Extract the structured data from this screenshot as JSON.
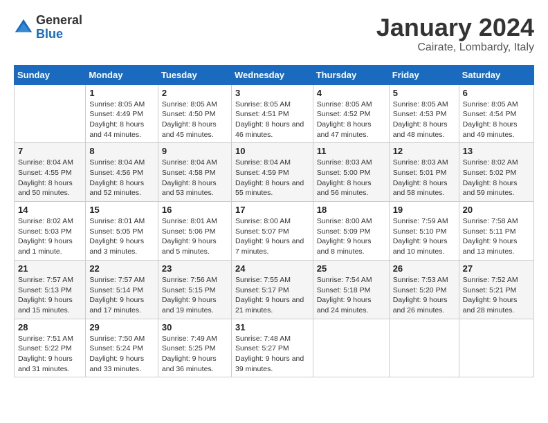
{
  "logo": {
    "general": "General",
    "blue": "Blue"
  },
  "title": "January 2024",
  "location": "Cairate, Lombardy, Italy",
  "weekdays": [
    "Sunday",
    "Monday",
    "Tuesday",
    "Wednesday",
    "Thursday",
    "Friday",
    "Saturday"
  ],
  "weeks": [
    [
      {
        "day": "",
        "sunrise": "",
        "sunset": "",
        "daylight": ""
      },
      {
        "day": "1",
        "sunrise": "Sunrise: 8:05 AM",
        "sunset": "Sunset: 4:49 PM",
        "daylight": "Daylight: 8 hours and 44 minutes."
      },
      {
        "day": "2",
        "sunrise": "Sunrise: 8:05 AM",
        "sunset": "Sunset: 4:50 PM",
        "daylight": "Daylight: 8 hours and 45 minutes."
      },
      {
        "day": "3",
        "sunrise": "Sunrise: 8:05 AM",
        "sunset": "Sunset: 4:51 PM",
        "daylight": "Daylight: 8 hours and 46 minutes."
      },
      {
        "day": "4",
        "sunrise": "Sunrise: 8:05 AM",
        "sunset": "Sunset: 4:52 PM",
        "daylight": "Daylight: 8 hours and 47 minutes."
      },
      {
        "day": "5",
        "sunrise": "Sunrise: 8:05 AM",
        "sunset": "Sunset: 4:53 PM",
        "daylight": "Daylight: 8 hours and 48 minutes."
      },
      {
        "day": "6",
        "sunrise": "Sunrise: 8:05 AM",
        "sunset": "Sunset: 4:54 PM",
        "daylight": "Daylight: 8 hours and 49 minutes."
      }
    ],
    [
      {
        "day": "7",
        "sunrise": "Sunrise: 8:04 AM",
        "sunset": "Sunset: 4:55 PM",
        "daylight": "Daylight: 8 hours and 50 minutes."
      },
      {
        "day": "8",
        "sunrise": "Sunrise: 8:04 AM",
        "sunset": "Sunset: 4:56 PM",
        "daylight": "Daylight: 8 hours and 52 minutes."
      },
      {
        "day": "9",
        "sunrise": "Sunrise: 8:04 AM",
        "sunset": "Sunset: 4:58 PM",
        "daylight": "Daylight: 8 hours and 53 minutes."
      },
      {
        "day": "10",
        "sunrise": "Sunrise: 8:04 AM",
        "sunset": "Sunset: 4:59 PM",
        "daylight": "Daylight: 8 hours and 55 minutes."
      },
      {
        "day": "11",
        "sunrise": "Sunrise: 8:03 AM",
        "sunset": "Sunset: 5:00 PM",
        "daylight": "Daylight: 8 hours and 56 minutes."
      },
      {
        "day": "12",
        "sunrise": "Sunrise: 8:03 AM",
        "sunset": "Sunset: 5:01 PM",
        "daylight": "Daylight: 8 hours and 58 minutes."
      },
      {
        "day": "13",
        "sunrise": "Sunrise: 8:02 AM",
        "sunset": "Sunset: 5:02 PM",
        "daylight": "Daylight: 8 hours and 59 minutes."
      }
    ],
    [
      {
        "day": "14",
        "sunrise": "Sunrise: 8:02 AM",
        "sunset": "Sunset: 5:03 PM",
        "daylight": "Daylight: 9 hours and 1 minute."
      },
      {
        "day": "15",
        "sunrise": "Sunrise: 8:01 AM",
        "sunset": "Sunset: 5:05 PM",
        "daylight": "Daylight: 9 hours and 3 minutes."
      },
      {
        "day": "16",
        "sunrise": "Sunrise: 8:01 AM",
        "sunset": "Sunset: 5:06 PM",
        "daylight": "Daylight: 9 hours and 5 minutes."
      },
      {
        "day": "17",
        "sunrise": "Sunrise: 8:00 AM",
        "sunset": "Sunset: 5:07 PM",
        "daylight": "Daylight: 9 hours and 7 minutes."
      },
      {
        "day": "18",
        "sunrise": "Sunrise: 8:00 AM",
        "sunset": "Sunset: 5:09 PM",
        "daylight": "Daylight: 9 hours and 8 minutes."
      },
      {
        "day": "19",
        "sunrise": "Sunrise: 7:59 AM",
        "sunset": "Sunset: 5:10 PM",
        "daylight": "Daylight: 9 hours and 10 minutes."
      },
      {
        "day": "20",
        "sunrise": "Sunrise: 7:58 AM",
        "sunset": "Sunset: 5:11 PM",
        "daylight": "Daylight: 9 hours and 13 minutes."
      }
    ],
    [
      {
        "day": "21",
        "sunrise": "Sunrise: 7:57 AM",
        "sunset": "Sunset: 5:13 PM",
        "daylight": "Daylight: 9 hours and 15 minutes."
      },
      {
        "day": "22",
        "sunrise": "Sunrise: 7:57 AM",
        "sunset": "Sunset: 5:14 PM",
        "daylight": "Daylight: 9 hours and 17 minutes."
      },
      {
        "day": "23",
        "sunrise": "Sunrise: 7:56 AM",
        "sunset": "Sunset: 5:15 PM",
        "daylight": "Daylight: 9 hours and 19 minutes."
      },
      {
        "day": "24",
        "sunrise": "Sunrise: 7:55 AM",
        "sunset": "Sunset: 5:17 PM",
        "daylight": "Daylight: 9 hours and 21 minutes."
      },
      {
        "day": "25",
        "sunrise": "Sunrise: 7:54 AM",
        "sunset": "Sunset: 5:18 PM",
        "daylight": "Daylight: 9 hours and 24 minutes."
      },
      {
        "day": "26",
        "sunrise": "Sunrise: 7:53 AM",
        "sunset": "Sunset: 5:20 PM",
        "daylight": "Daylight: 9 hours and 26 minutes."
      },
      {
        "day": "27",
        "sunrise": "Sunrise: 7:52 AM",
        "sunset": "Sunset: 5:21 PM",
        "daylight": "Daylight: 9 hours and 28 minutes."
      }
    ],
    [
      {
        "day": "28",
        "sunrise": "Sunrise: 7:51 AM",
        "sunset": "Sunset: 5:22 PM",
        "daylight": "Daylight: 9 hours and 31 minutes."
      },
      {
        "day": "29",
        "sunrise": "Sunrise: 7:50 AM",
        "sunset": "Sunset: 5:24 PM",
        "daylight": "Daylight: 9 hours and 33 minutes."
      },
      {
        "day": "30",
        "sunrise": "Sunrise: 7:49 AM",
        "sunset": "Sunset: 5:25 PM",
        "daylight": "Daylight: 9 hours and 36 minutes."
      },
      {
        "day": "31",
        "sunrise": "Sunrise: 7:48 AM",
        "sunset": "Sunset: 5:27 PM",
        "daylight": "Daylight: 9 hours and 39 minutes."
      },
      {
        "day": "",
        "sunrise": "",
        "sunset": "",
        "daylight": ""
      },
      {
        "day": "",
        "sunrise": "",
        "sunset": "",
        "daylight": ""
      },
      {
        "day": "",
        "sunrise": "",
        "sunset": "",
        "daylight": ""
      }
    ]
  ]
}
